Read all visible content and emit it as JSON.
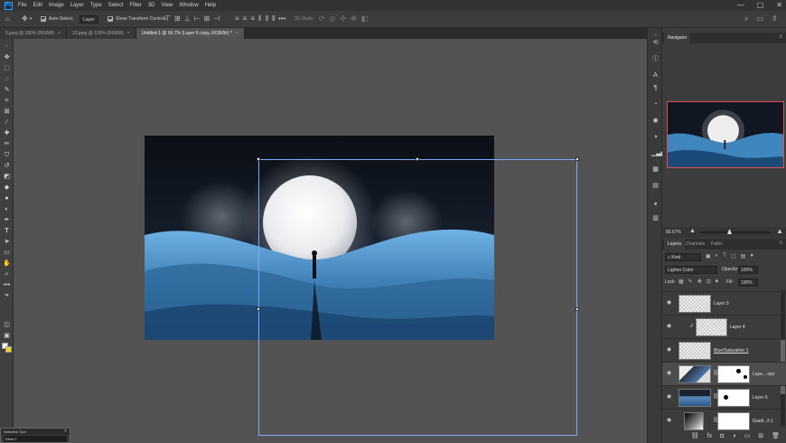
{
  "app": {
    "logo": "Ps"
  },
  "menu": [
    "File",
    "Edit",
    "Image",
    "Layer",
    "Type",
    "Select",
    "Filter",
    "3D",
    "View",
    "Window",
    "Help"
  ],
  "window_controls": {
    "minimize": "—",
    "maximize": "▢",
    "close": "✕"
  },
  "options": {
    "auto_select_label": "Auto-Select:",
    "auto_select_value": "Layer",
    "show_transform_label": "Show Transform Controls",
    "mode_3d_label": "3D Mode:"
  },
  "tabs": [
    {
      "label": "5.jpeg @ 100% (RGB/8)"
    },
    {
      "label": "13.jpeg @ 100% (RGB/8)"
    },
    {
      "label": "Untitled-1 @ 66.7% (Layer 6 copy, RGB/8#) *"
    }
  ],
  "panels": {
    "navigator_tab": "Navigator",
    "zoom": "66.67%",
    "layer_tabs": [
      "Layers",
      "Channels",
      "Paths"
    ],
    "kind_label": "Kind",
    "blend_mode": "Lighter Color",
    "opacity_label": "Opacity:",
    "opacity_value": "100%",
    "lock_label": "Lock:",
    "fill_label": "Fill:",
    "fill_value": "100%"
  },
  "layers": [
    {
      "name": "Layer 3"
    },
    {
      "name": "Layer 4"
    },
    {
      "name": "Blue/Saturation 1"
    },
    {
      "name": "Laye... opy"
    },
    {
      "name": "Layer 6"
    },
    {
      "name": "Gradi...ll 1"
    }
  ],
  "selwidget": {
    "title": "Selective Tool",
    "value": "Dline 2"
  },
  "colors": {
    "accent": "#31a8ff",
    "nav_frame": "#e34f4f",
    "bbox": "#7aa9ff"
  }
}
